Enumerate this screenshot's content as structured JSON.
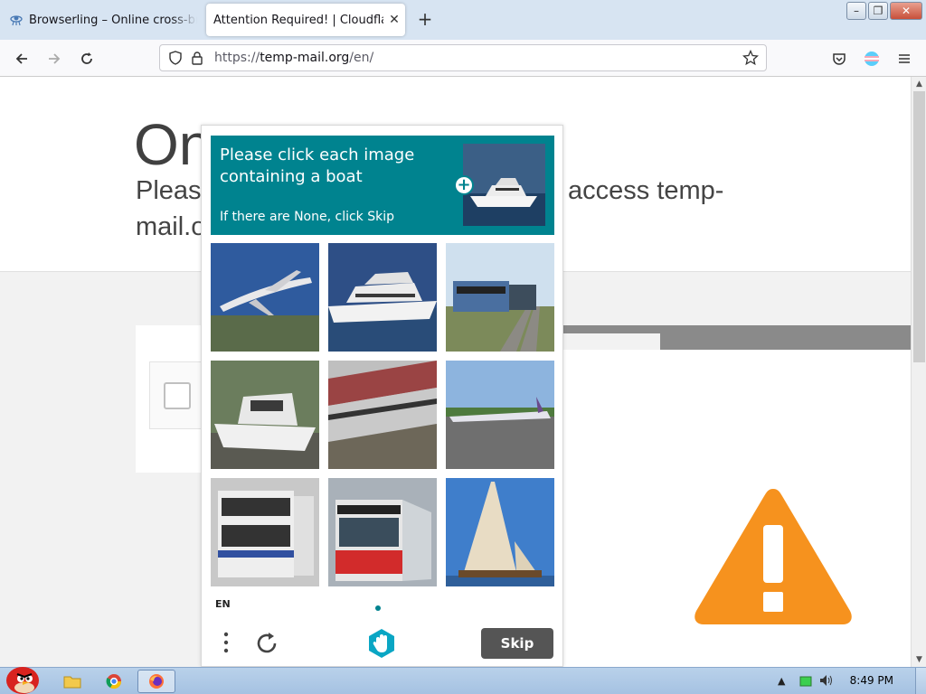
{
  "browser": {
    "tabs": [
      {
        "title": "Browserling – Online cross-browser testing",
        "active": false
      },
      {
        "title": "Attention Required! | Cloudflare",
        "active": true
      }
    ],
    "url_scheme": "https://",
    "url_host": "temp-mail.org",
    "url_path": "/en/"
  },
  "page": {
    "heading": "On",
    "subtitle_start": "Please",
    "subtitle_end": "access temp-",
    "subtitle_line2": "mail.o"
  },
  "captcha": {
    "prompt_title": "Please click each image containing a boat",
    "prompt_sub": "If there are None, click Skip",
    "images": [
      {
        "subject": "airplane"
      },
      {
        "subject": "yacht"
      },
      {
        "subject": "train"
      },
      {
        "subject": "boat"
      },
      {
        "subject": "train"
      },
      {
        "subject": "airplane"
      },
      {
        "subject": "bus"
      },
      {
        "subject": "bus"
      },
      {
        "subject": "sailboat"
      }
    ],
    "language": "EN",
    "skip_label": "Skip"
  },
  "taskbar": {
    "clock": "8:49 PM"
  },
  "colors": {
    "captcha_accent": "#00838f",
    "warning": "#f6921e",
    "skip_button": "#555555"
  }
}
